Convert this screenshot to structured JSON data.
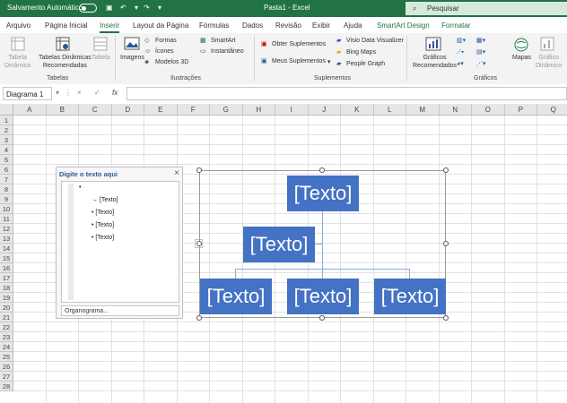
{
  "titlebar": {
    "autosave_label": "Salvamento Automático",
    "doc_title": "Pasta1  -  Excel",
    "search_placeholder": "Pesquisar",
    "accent": "#217346"
  },
  "tabs": [
    "Arquivo",
    "Página Inicial",
    "Inserir",
    "Layout da Página",
    "Fórmulas",
    "Dados",
    "Revisão",
    "Exibir",
    "Ajuda",
    "SmartArt Design",
    "Formatar"
  ],
  "active_tab": "Inserir",
  "ribbon": {
    "tabelas": {
      "group": "Tabelas",
      "tabela_dinamica": "Tabela\nDinâmica",
      "tabelas_recomendadas": "Tabelas Dinâmicas\nRecomendadas",
      "tabela": "Tabela"
    },
    "ilustracoes": {
      "group": "Ilustrações",
      "imagens": "Imagens",
      "formas": "Formas",
      "icones": "Ícones",
      "modelos3d": "Modelos 3D",
      "smartart": "SmartArt",
      "instantaneo": "Instantâneo"
    },
    "suplementos": {
      "group": "Suplementos",
      "obter": "Obter Suplementos",
      "meus": "Meus Suplementos",
      "visio": "Visio Data Visualizer",
      "bing": "Bing Maps",
      "people": "People Graph"
    },
    "graficos": {
      "group": "Gráficos",
      "recomendados": "Gráficos\nRecomendados",
      "mapas": "Mapas",
      "grafico_dinamico": "Gráfico\nDinâmico"
    }
  },
  "formula_bar": {
    "name_box": "Diagrama 1",
    "cancel": "×",
    "enter": "✓",
    "fx": "fx",
    "value": ""
  },
  "columns": [
    "A",
    "B",
    "C",
    "D",
    "E",
    "F",
    "G",
    "H",
    "I",
    "J",
    "K",
    "L",
    "M",
    "N",
    "O",
    "P",
    "Q"
  ],
  "rows": [
    "1",
    "2",
    "3",
    "4",
    "5",
    "6",
    "7",
    "8",
    "9",
    "10",
    "11",
    "12",
    "13",
    "14",
    "15",
    "16",
    "17",
    "18",
    "19",
    "20",
    "21",
    "22",
    "23",
    "24",
    "25",
    "26",
    "27",
    "28"
  ],
  "text_pane": {
    "title": "Digite o texto aqui",
    "close": "×",
    "items": [
      "[Texto]",
      "[Texto]",
      "[Texto]",
      "[Texto]"
    ],
    "footer": "Organograma..."
  },
  "smartart": {
    "top": "[Texto]",
    "assistant": "[Texto]",
    "children": [
      "[Texto]",
      "[Texto]",
      "[Texto]"
    ],
    "fill": "#4472c4",
    "line": "#8eaadb"
  }
}
